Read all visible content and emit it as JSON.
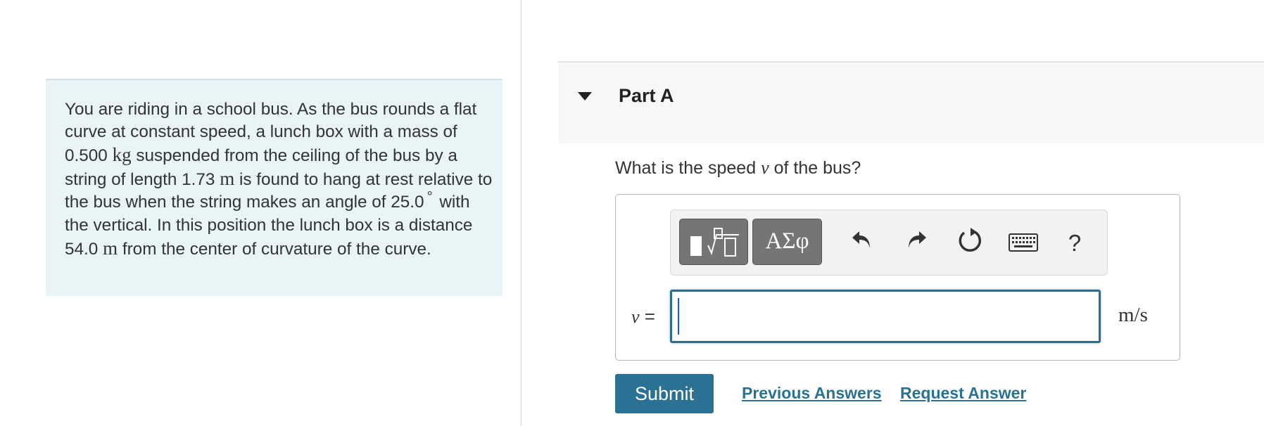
{
  "problem": {
    "text_1": "You are riding in a school bus. As the bus rounds a flat curve at constant speed, a lunch box with a mass of 0.500",
    "mass_unit": "kg",
    "text_2": "suspended from the ceiling of the bus by a string of length 1.73",
    "length_unit": "m",
    "text_3": "is found to hang at rest relative to the bus when the string makes an angle of 25.0",
    "degree": "°",
    "text_4": "with the vertical. In this position the lunch box is a distance 54.0",
    "distance_unit": "m",
    "text_5": "from the center of curvature of the curve."
  },
  "part": {
    "title": "Part A"
  },
  "question": {
    "prefix": "What is the speed",
    "variable": "v",
    "suffix": "of the bus?"
  },
  "toolbar": {
    "greek_label": "ΑΣφ",
    "help_label": "?",
    "icons": [
      "templates-icon",
      "greek-symbols-icon",
      "undo-icon",
      "redo-icon",
      "reset-icon",
      "keyboard-icon",
      "help-icon"
    ]
  },
  "answer": {
    "variable": "v",
    "equals": "=",
    "value": "",
    "units": "m/s"
  },
  "actions": {
    "submit_label": "Submit",
    "previous_answers_label": "Previous Answers",
    "request_answer_label": "Request Answer"
  },
  "colors": {
    "accent": "#2a7193",
    "problem_bg": "#e9f4f7",
    "header_bg": "#f7f7f7"
  }
}
